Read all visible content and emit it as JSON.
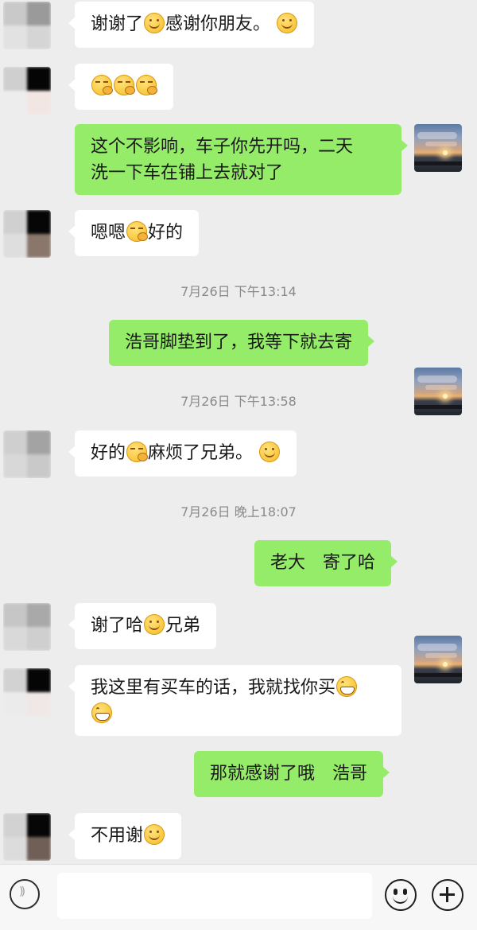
{
  "messages": [
    {
      "from": "friend",
      "segments": [
        "谢谢了",
        "感谢你朋友。"
      ]
    },
    {
      "from": "friend",
      "segments": []
    },
    {
      "from": "me",
      "line1": "这个不影响，车子你先开吗，二天",
      "line2": "洗一下车在铺上去就对了"
    },
    {
      "from": "friend",
      "segments": [
        "嗯嗯",
        "好的"
      ]
    },
    {
      "from": "me",
      "text": "浩哥脚垫到了，我等下就去寄"
    },
    {
      "from": "friend",
      "segments": [
        "好的",
        "麻烦了兄弟。"
      ]
    },
    {
      "from": "me",
      "text": "老大　寄了哈"
    },
    {
      "from": "friend",
      "segments": [
        "谢了哈",
        "兄弟"
      ]
    },
    {
      "from": "friend",
      "line1": "我这里有买车的话，我就找你买"
    },
    {
      "from": "me",
      "text": "那就感谢了哦　浩哥"
    },
    {
      "from": "friend",
      "segments": [
        "不用谢"
      ]
    }
  ],
  "timestamps": [
    "7月26日 下午13:14",
    "7月26日 下午13:58",
    "7月26日 晚上18:07"
  ],
  "input": {
    "placeholder": ""
  },
  "icons": {
    "voice": "voice-input-icon",
    "emoji": "emoji-face-icon",
    "more": "plus-circle-icon",
    "smile": "smile-emoji-icon",
    "sly": "sly-smile-emoji-icon",
    "grin": "grin-emoji-icon"
  },
  "colors": {
    "background": "#ededed",
    "outgoing_bubble": "#95ec69",
    "incoming_bubble": "#ffffff",
    "timestamp": "#8a8a8a"
  }
}
